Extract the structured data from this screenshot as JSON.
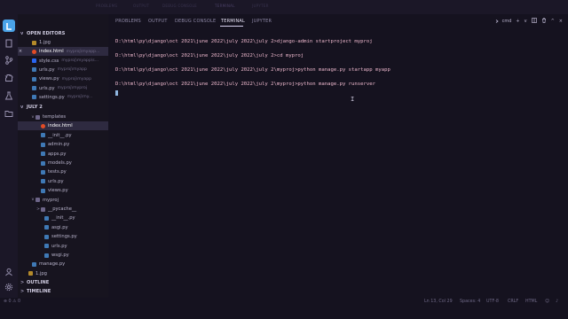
{
  "titlebar": {
    "ghost_tabs": [
      "PROBLEMS",
      "OUTPUT",
      "DEBUG CONSOLE",
      "TERMINAL",
      "JUPYTER"
    ]
  },
  "activity_bar": {
    "icons": [
      "app-logo-icon",
      "files-icon",
      "source-control-icon",
      "extensions-icon",
      "flask-icon",
      "folder-icon",
      "account-icon",
      "gear-icon"
    ]
  },
  "sidebar": {
    "open_editors": {
      "header": "OPEN EDITORS",
      "items": [
        {
          "name": "1.jpg",
          "desc": "",
          "type": "img",
          "close": false,
          "selected": false
        },
        {
          "name": "index.html",
          "desc": "myproj\\myapp...",
          "type": "html",
          "close": true,
          "selected": true
        },
        {
          "name": "style.css",
          "desc": "myproj\\myapp\\s...",
          "type": "css",
          "close": false,
          "selected": false
        },
        {
          "name": "urls.py",
          "desc": "myproj\\myapp",
          "type": "py",
          "close": false,
          "selected": false
        },
        {
          "name": "views.py",
          "desc": "myproj\\myapp",
          "type": "py",
          "close": false,
          "selected": false
        },
        {
          "name": "urls.py",
          "desc": "myproj\\myproj",
          "type": "py",
          "close": false,
          "selected": false
        },
        {
          "name": "settings.py",
          "desc": "myproj\\my...",
          "type": "py",
          "close": false,
          "selected": false
        }
      ]
    },
    "workspace": {
      "header": "JULY 2",
      "items": [
        {
          "name": "templates",
          "type": "folder",
          "twisty": "v"
        },
        {
          "name": "index.html",
          "type": "html",
          "twisty": ""
        },
        {
          "name": "__init__.py",
          "type": "py",
          "twisty": ""
        },
        {
          "name": "admin.py",
          "type": "py",
          "twisty": ""
        },
        {
          "name": "apps.py",
          "type": "py",
          "twisty": ""
        },
        {
          "name": "models.py",
          "type": "py",
          "twisty": ""
        },
        {
          "name": "tests.py",
          "type": "py",
          "twisty": ""
        },
        {
          "name": "urls.py",
          "type": "py",
          "twisty": ""
        },
        {
          "name": "views.py",
          "type": "py",
          "twisty": ""
        },
        {
          "name": "myproj",
          "type": "folder",
          "twisty": "v"
        },
        {
          "name": "__pycache__",
          "type": "folder",
          "twisty": ">"
        },
        {
          "name": "__init__.py",
          "type": "py",
          "twisty": ""
        },
        {
          "name": "asgi.py",
          "type": "py",
          "twisty": ""
        },
        {
          "name": "settings.py",
          "type": "py",
          "twisty": ""
        },
        {
          "name": "urls.py",
          "type": "py",
          "twisty": ""
        },
        {
          "name": "wsgi.py",
          "type": "py",
          "twisty": ""
        },
        {
          "name": "manage.py",
          "type": "py",
          "twisty": ""
        },
        {
          "name": "1.jpg",
          "type": "img",
          "twisty": ""
        }
      ]
    },
    "outline": "OUTLINE",
    "timeline": "TIMELINE"
  },
  "panel": {
    "tabs": [
      "PROBLEMS",
      "OUTPUT",
      "DEBUG CONSOLE",
      "TERMINAL",
      "JUPYTER"
    ],
    "active_tab": "TERMINAL",
    "shell_label": "cmd",
    "action_icons": [
      "plus-icon",
      "chevron-down-icon",
      "split-icon",
      "trash-icon",
      "chevron-up-icon",
      "close-icon"
    ],
    "terminal_lines": [
      "D:\\html\\py\\django\\oct 2021\\june 2022\\july 2022\\july 2>django-admin startproject myproj",
      "D:\\html\\py\\django\\oct 2021\\june 2022\\july 2022\\july 2>cd myproj",
      "D:\\html\\py\\django\\oct 2021\\june 2022\\july 2022\\july 2\\myproj>python manage.py startapp myapp",
      "D:\\html\\py\\django\\oct 2021\\june 2022\\july 2022\\july 2\\myproj>python manage.py runserver"
    ]
  },
  "statusbar": {
    "left": "⊗ 0 ⚠ 0",
    "position": "Ln 13, Col 29",
    "spaces": "Spaces: 4",
    "encoding": "UTF-8",
    "eol": "CRLF",
    "language": "HTML",
    "colors": {
      "accent": "#4aa3e8",
      "terminal_text": "#ecb7cc",
      "background": "#15121f"
    }
  }
}
